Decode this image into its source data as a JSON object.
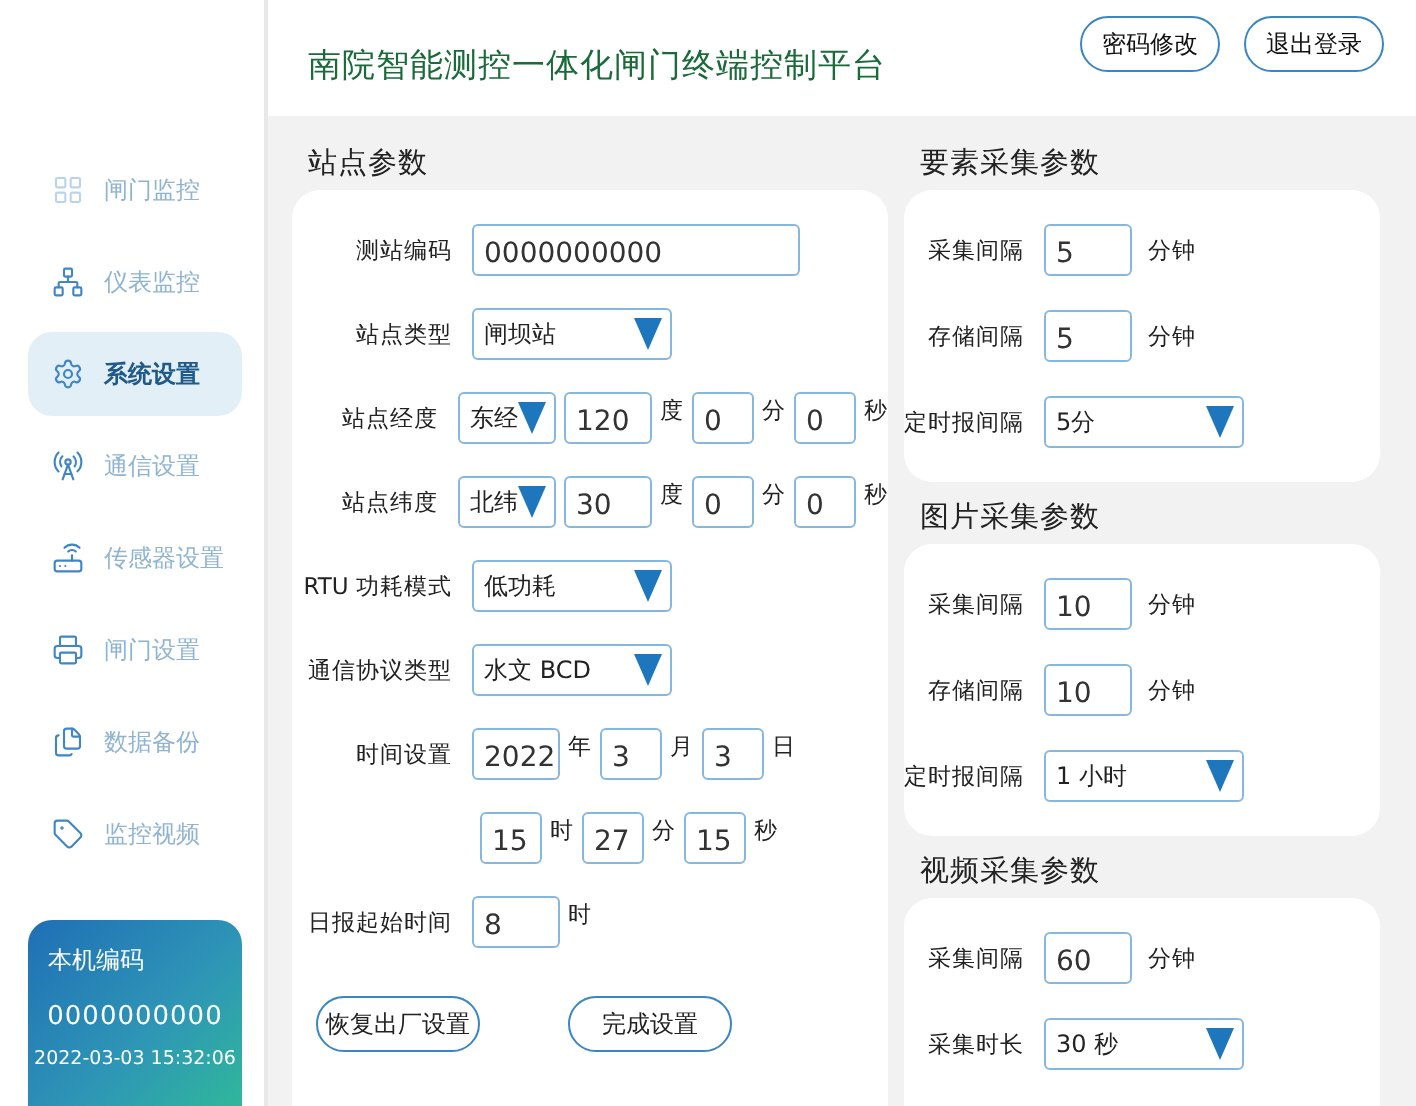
{
  "header": {
    "title": "南院智能测控一体化闸门终端控制平台",
    "buttons": [
      "密码修改",
      "退出登录"
    ]
  },
  "sidebar": {
    "items": [
      {
        "label": "闸门监控",
        "selected": false
      },
      {
        "label": "仪表监控",
        "selected": false
      },
      {
        "label": "系统设置",
        "selected": true
      },
      {
        "label": "通信设置",
        "selected": false
      },
      {
        "label": "传感器设置",
        "selected": false
      },
      {
        "label": "闸门设置",
        "selected": false
      },
      {
        "label": "数据备份",
        "selected": false
      },
      {
        "label": "监控视频",
        "selected": false
      }
    ],
    "device_card": {
      "label": "本机编码",
      "code": "0000000000",
      "datetime": "2022-03-03 15:32:06"
    }
  },
  "station": {
    "title": "站点参数",
    "rows": [
      {
        "label": "测站编码",
        "parts": [
          {
            "kind": "wide",
            "value": "0000000000"
          }
        ]
      },
      {
        "label": "站点类型",
        "parts": [
          {
            "kind": "select",
            "value": "闸坝站"
          }
        ]
      },
      {
        "label": "站点经度",
        "parts": [
          {
            "kind": "short-select",
            "value": "东经"
          },
          {
            "kind": "input",
            "value": "120"
          },
          {
            "kind": "unit",
            "value": "度"
          },
          {
            "kind": "small",
            "value": "0"
          },
          {
            "kind": "unit",
            "value": "分"
          },
          {
            "kind": "small",
            "value": "0"
          },
          {
            "kind": "unit",
            "value": "秒"
          }
        ]
      },
      {
        "label": "站点纬度",
        "parts": [
          {
            "kind": "short-select",
            "value": "北纬"
          },
          {
            "kind": "input",
            "value": "30"
          },
          {
            "kind": "unit",
            "value": "度"
          },
          {
            "kind": "small",
            "value": "0"
          },
          {
            "kind": "unit",
            "value": "分"
          },
          {
            "kind": "small",
            "value": "0"
          },
          {
            "kind": "unit",
            "value": "秒"
          }
        ]
      },
      {
        "label": "RTU 功耗模式",
        "parts": [
          {
            "kind": "select",
            "value": "低功耗"
          }
        ]
      },
      {
        "label": "通信协议类型",
        "parts": [
          {
            "kind": "select",
            "value": "水文 BCD"
          }
        ]
      },
      {
        "label": "时间设置",
        "parts": [
          {
            "kind": "input",
            "value": "2022"
          },
          {
            "kind": "unit",
            "value": "年"
          },
          {
            "kind": "small",
            "value": "3"
          },
          {
            "kind": "unit",
            "value": "月"
          },
          {
            "kind": "small",
            "value": "3"
          },
          {
            "kind": "unit",
            "value": "日"
          }
        ]
      },
      {
        "parts": [
          {
            "kind": "small",
            "value": "15"
          },
          {
            "kind": "unit",
            "value": "时"
          },
          {
            "kind": "small",
            "value": "27"
          },
          {
            "kind": "unit",
            "value": "分"
          },
          {
            "kind": "small",
            "value": "15"
          },
          {
            "kind": "unit",
            "value": "秒"
          }
        ]
      },
      {
        "label": "日报起始时间",
        "parts": [
          {
            "kind": "input",
            "value": "8"
          },
          {
            "kind": "unit",
            "value": "时"
          }
        ]
      }
    ],
    "buttons": [
      "恢复出厂设置",
      "完成设置"
    ]
  },
  "sections": [
    {
      "title": "要素采集参数",
      "rows": [
        {
          "label": "采集间隔",
          "kind": "input",
          "value": "5",
          "unit": "分钟"
        },
        {
          "label": "存储间隔",
          "kind": "input",
          "value": "5",
          "unit": "分钟"
        },
        {
          "label": "定时报间隔",
          "kind": "select",
          "value": "5分"
        }
      ]
    },
    {
      "title": "图片采集参数",
      "rows": [
        {
          "label": "采集间隔",
          "kind": "input",
          "value": "10",
          "unit": "分钟"
        },
        {
          "label": "存储间隔",
          "kind": "input",
          "value": "10",
          "unit": "分钟"
        },
        {
          "label": "定时报间隔",
          "kind": "select",
          "value": "1 小时"
        }
      ]
    },
    {
      "title": "视频采集参数",
      "rows": [
        {
          "label": "采集间隔",
          "kind": "input",
          "value": "60",
          "unit": "分钟"
        },
        {
          "label": "采集时长",
          "kind": "select",
          "value": "30 秒"
        }
      ]
    }
  ]
}
